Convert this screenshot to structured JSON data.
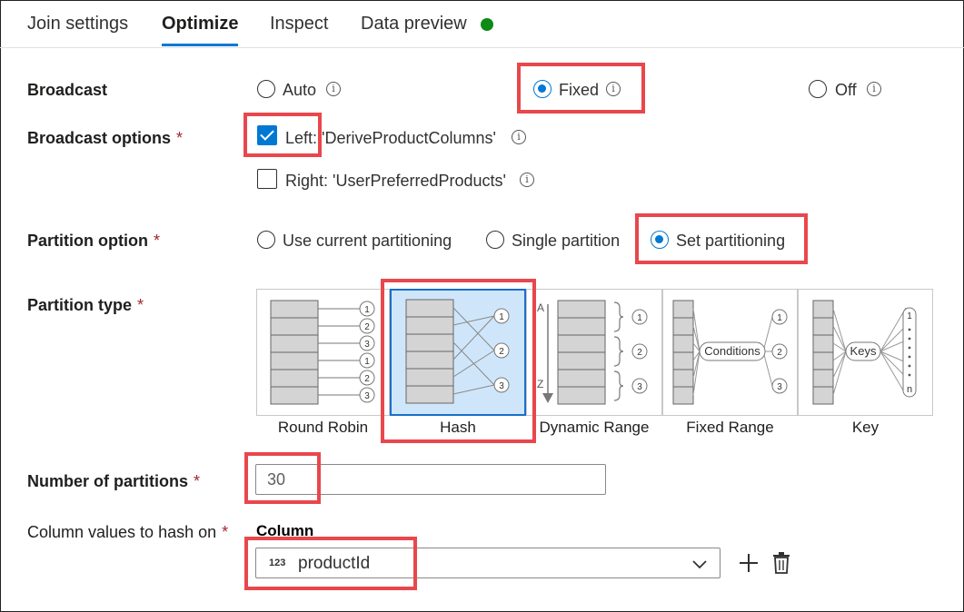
{
  "tabs": [
    "Join settings",
    "Optimize",
    "Inspect",
    "Data preview"
  ],
  "active_tab": "Optimize",
  "status_color": "#0e8a16",
  "broadcast": {
    "label": "Broadcast",
    "options": [
      "Auto",
      "Fixed",
      "Off"
    ],
    "selected": "Fixed"
  },
  "broadcast_options": {
    "label": "Broadcast options",
    "required": "*",
    "left": "Left: 'DeriveProductColumns'",
    "right": "Right: 'UserPreferredProducts'",
    "left_checked": true,
    "right_checked": false
  },
  "partition_option": {
    "label": "Partition option",
    "required": "*",
    "options": [
      "Use current partitioning",
      "Single partition",
      "Set partitioning"
    ],
    "selected": "Set partitioning"
  },
  "partition_type": {
    "label": "Partition type",
    "required": "*",
    "types": [
      "Round Robin",
      "Hash",
      "Dynamic Range",
      "Fixed Range",
      "Key"
    ],
    "selected": "Hash",
    "diagram_text": {
      "range_top": "A",
      "range_bottom": "Z",
      "conditions": "Conditions",
      "keys": "Keys",
      "n": "n",
      "numbers": [
        "1",
        "2",
        "3"
      ]
    }
  },
  "num_partitions": {
    "label": "Number of partitions",
    "required": "*",
    "value": "30"
  },
  "hash_columns": {
    "label": "Column values to hash on",
    "required": "*",
    "column_header": "Column",
    "type_tag": "123",
    "value": "productId"
  },
  "icons": [
    "info-icon",
    "chevron-down-icon",
    "add-icon",
    "delete-icon"
  ],
  "colors": {
    "accent": "#0078d4",
    "highlight": "#e8474d",
    "selected_bg": "#cfe6fa"
  }
}
